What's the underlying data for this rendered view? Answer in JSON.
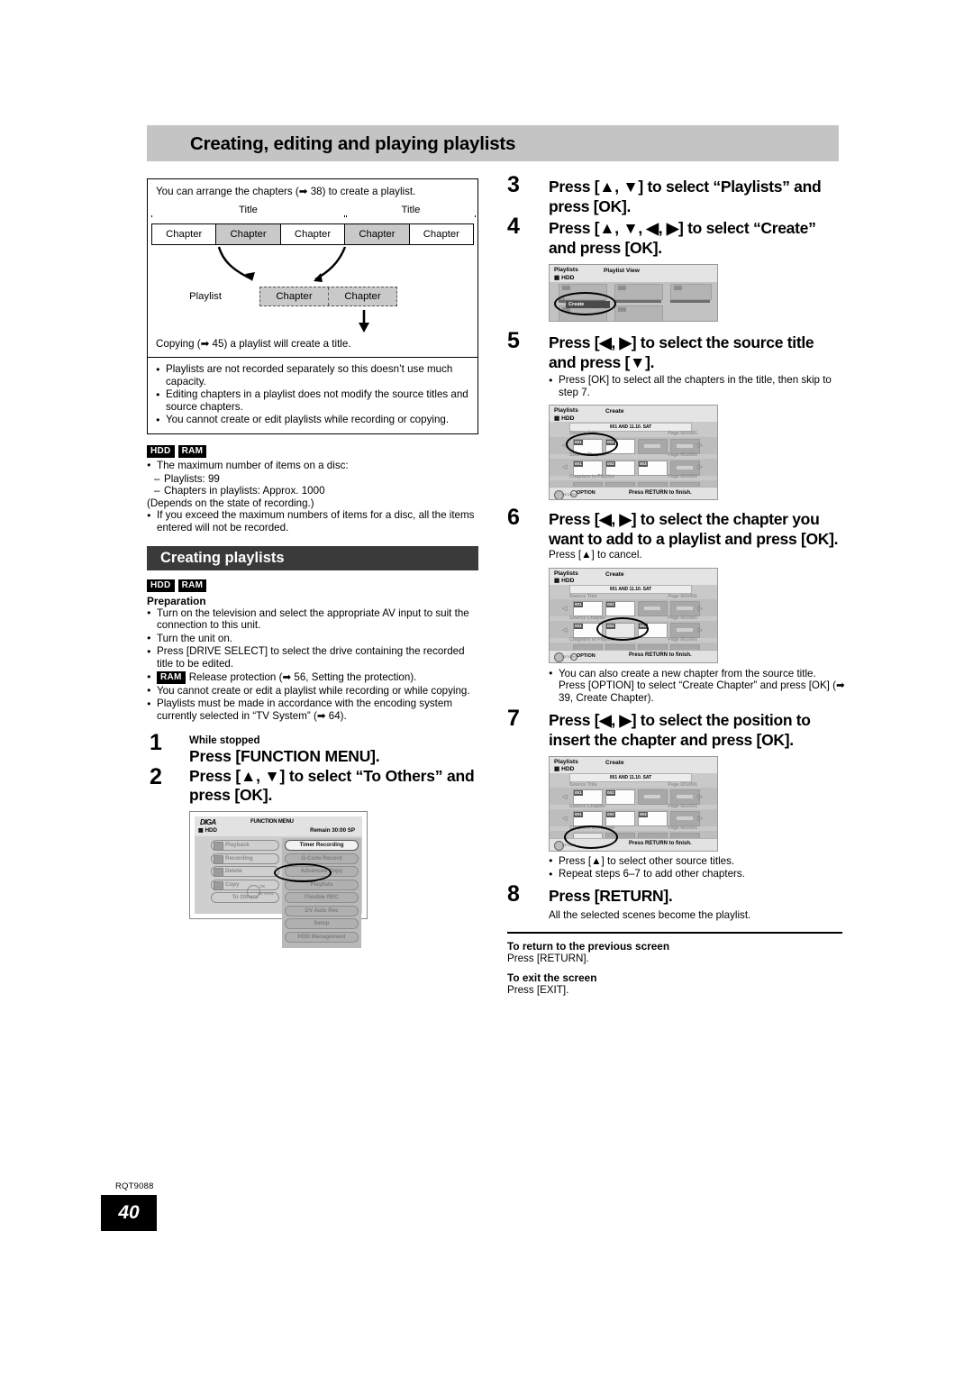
{
  "header": {
    "title": "Creating, editing and playing playlists"
  },
  "intro": {
    "lead": "You can arrange the chapters (➡ 38) to create a playlist.",
    "title_label_1": "Title",
    "title_label_2": "Title",
    "chapters": [
      {
        "label": "Chapter",
        "selected": false
      },
      {
        "label": "Chapter",
        "selected": true
      },
      {
        "label": "Chapter",
        "selected": false
      },
      {
        "label": "Chapter",
        "selected": true
      },
      {
        "label": "Chapter",
        "selected": false
      }
    ],
    "playlist_label": "Playlist",
    "playlist_chapters": [
      "Chapter",
      "Chapter"
    ],
    "copying_line": "Copying (➡ 45) a playlist will create a title.",
    "notes": [
      "Playlists are not recorded separately so this doesn’t use much capacity.",
      "Editing chapters in a playlist does not modify the source titles and source chapters.",
      "You cannot create or edit playlists while recording or copying."
    ]
  },
  "limits": {
    "badges": [
      "HDD",
      "RAM"
    ],
    "line1": "The maximum number of items on a disc:",
    "dash1": "Playlists: 99",
    "dash2": "Chapters in playlists: Approx. 1000",
    "line2": "(Depends on the state of recording.)",
    "line3": "If you exceed the maximum numbers of items for a disc, all the items entered will not be recorded."
  },
  "section": {
    "title": "Creating playlists",
    "badges": [
      "HDD",
      "RAM"
    ],
    "preparation_label": "Preparation",
    "prep_items": [
      "Turn on the television and select the appropriate AV input to suit the connection to this unit.",
      "Turn the unit on.",
      "Press [DRIVE SELECT] to select the drive containing the recorded title to be edited.",
      "Release protection (➡ 56, Setting the protection).",
      "You cannot create or edit a playlist while recording or while copying.",
      "Playlists must be made in accordance with the encoding system currently selected in “TV System” (➡ 64)."
    ],
    "prep_ram_badge": "RAM"
  },
  "steps": {
    "s1": {
      "num": "1",
      "sub": "While stopped",
      "text": "Press [FUNCTION MENU]."
    },
    "s2": {
      "num": "2",
      "text": "Press [▲, ▼] to select “To Others” and press [OK]."
    },
    "s3": {
      "num": "3",
      "text": "Press [▲, ▼] to select “Playlists” and press [OK]."
    },
    "s4": {
      "num": "4",
      "text": "Press [▲, ▼, ◀, ▶] to select “Create” and press [OK]."
    },
    "s5": {
      "num": "5",
      "text": "Press [◀, ▶] to select the source title and press [▼].",
      "note": "Press [OK] to select all the chapters in the title, then skip to step 7."
    },
    "s6": {
      "num": "6",
      "text": "Press [◀, ▶] to select the chapter you want to add to a playlist and press [OK].",
      "note": "Press [▲] to cancel.",
      "after_note_1": "You can also create a new chapter from the source title. Press [OPTION] to select “Create Chapter” and press [OK] (➡ 39, Create Chapter)."
    },
    "s7": {
      "num": "7",
      "text": "Press [◀, ▶] to select the position to insert the chapter and press [OK].",
      "note1": "Press [▲] to select other source titles.",
      "note2": "Repeat steps 6–7 to add other chapters."
    },
    "s8": {
      "num": "8",
      "text": "Press [RETURN].",
      "note": "All the selected scenes become the playlist."
    }
  },
  "closing": {
    "return_title": "To return to the previous screen",
    "return_text": "Press [RETURN].",
    "exit_title": "To exit the screen",
    "exit_text": "Press [EXIT]."
  },
  "function_menu_shot": {
    "brand": "DIGA",
    "title": "FUNCTION MENU",
    "drive": "HDD",
    "remain": "Remain  30:00 SP",
    "left_items": [
      "Playback",
      "Recording",
      "Delete",
      "Copy",
      "To Others"
    ],
    "right_items": [
      "Timer Recording",
      "G-Code Record",
      "Advanced Copy",
      "Playlists",
      "Flexible REC",
      "DV Auto Rec",
      "Setup",
      "HDD Management"
    ],
    "highlighted_right": "Timer Recording",
    "circled_right": "Playlists",
    "dial_ok": "OK",
    "dial_return": "RETURN"
  },
  "playlist_view_shot": {
    "header_left": "Playlists",
    "header_drive": "HDD",
    "header_title": "Playlist View",
    "create_label": "Create"
  },
  "create_shot": {
    "header_left": "Playlists",
    "header_drive": "HDD",
    "header_title": "Create",
    "title_bar": "001 AND 11.10. SAT",
    "row1_label": "Source Title",
    "row2_label": "Source Chapter",
    "row3_label": "Chapters in Playlist",
    "page_label": "Page 001/001",
    "option_label": "OPTION",
    "finish_label": "Press RETURN to finish.",
    "dial_return": "RETURN",
    "source_title_cells": [
      "001",
      "002",
      "",
      ""
    ],
    "source_chapter_cells": [
      "001",
      "002",
      "003",
      ""
    ],
    "playlist_cells": [
      "",
      "",
      "",
      ""
    ]
  },
  "footer": {
    "code": "RQT9088",
    "page": "40"
  }
}
